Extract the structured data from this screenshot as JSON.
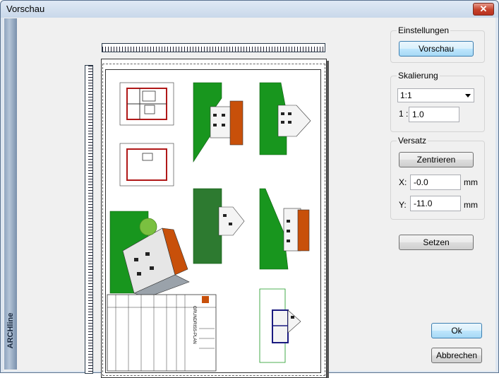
{
  "window": {
    "title": "Vorschau",
    "close_glyph": "✕"
  },
  "brand": {
    "label": "ARCHline"
  },
  "preview": {
    "titleblock_text": "GRUNDRISS-PLAN"
  },
  "settings": {
    "einstellungen_label": "Einstellungen",
    "vorschau_button": "Vorschau",
    "skalierung_label": "Skalierung",
    "scale_selected": "1:1",
    "scale_prefix": "1 :",
    "scale_value": "1.0",
    "versatz_label": "Versatz",
    "zentrieren_button": "Zentrieren",
    "x_label": "X:",
    "x_value": "-0.0",
    "x_unit": "mm",
    "y_label": "Y:",
    "y_value": "-11.0",
    "y_unit": "mm",
    "setzen_button": "Setzen",
    "ok_button": "Ok",
    "abbrechen_button": "Abbrechen"
  },
  "colors": {
    "accent_green": "#18961e",
    "roof_orange": "#c8500a",
    "wall_red": "#b01818"
  }
}
